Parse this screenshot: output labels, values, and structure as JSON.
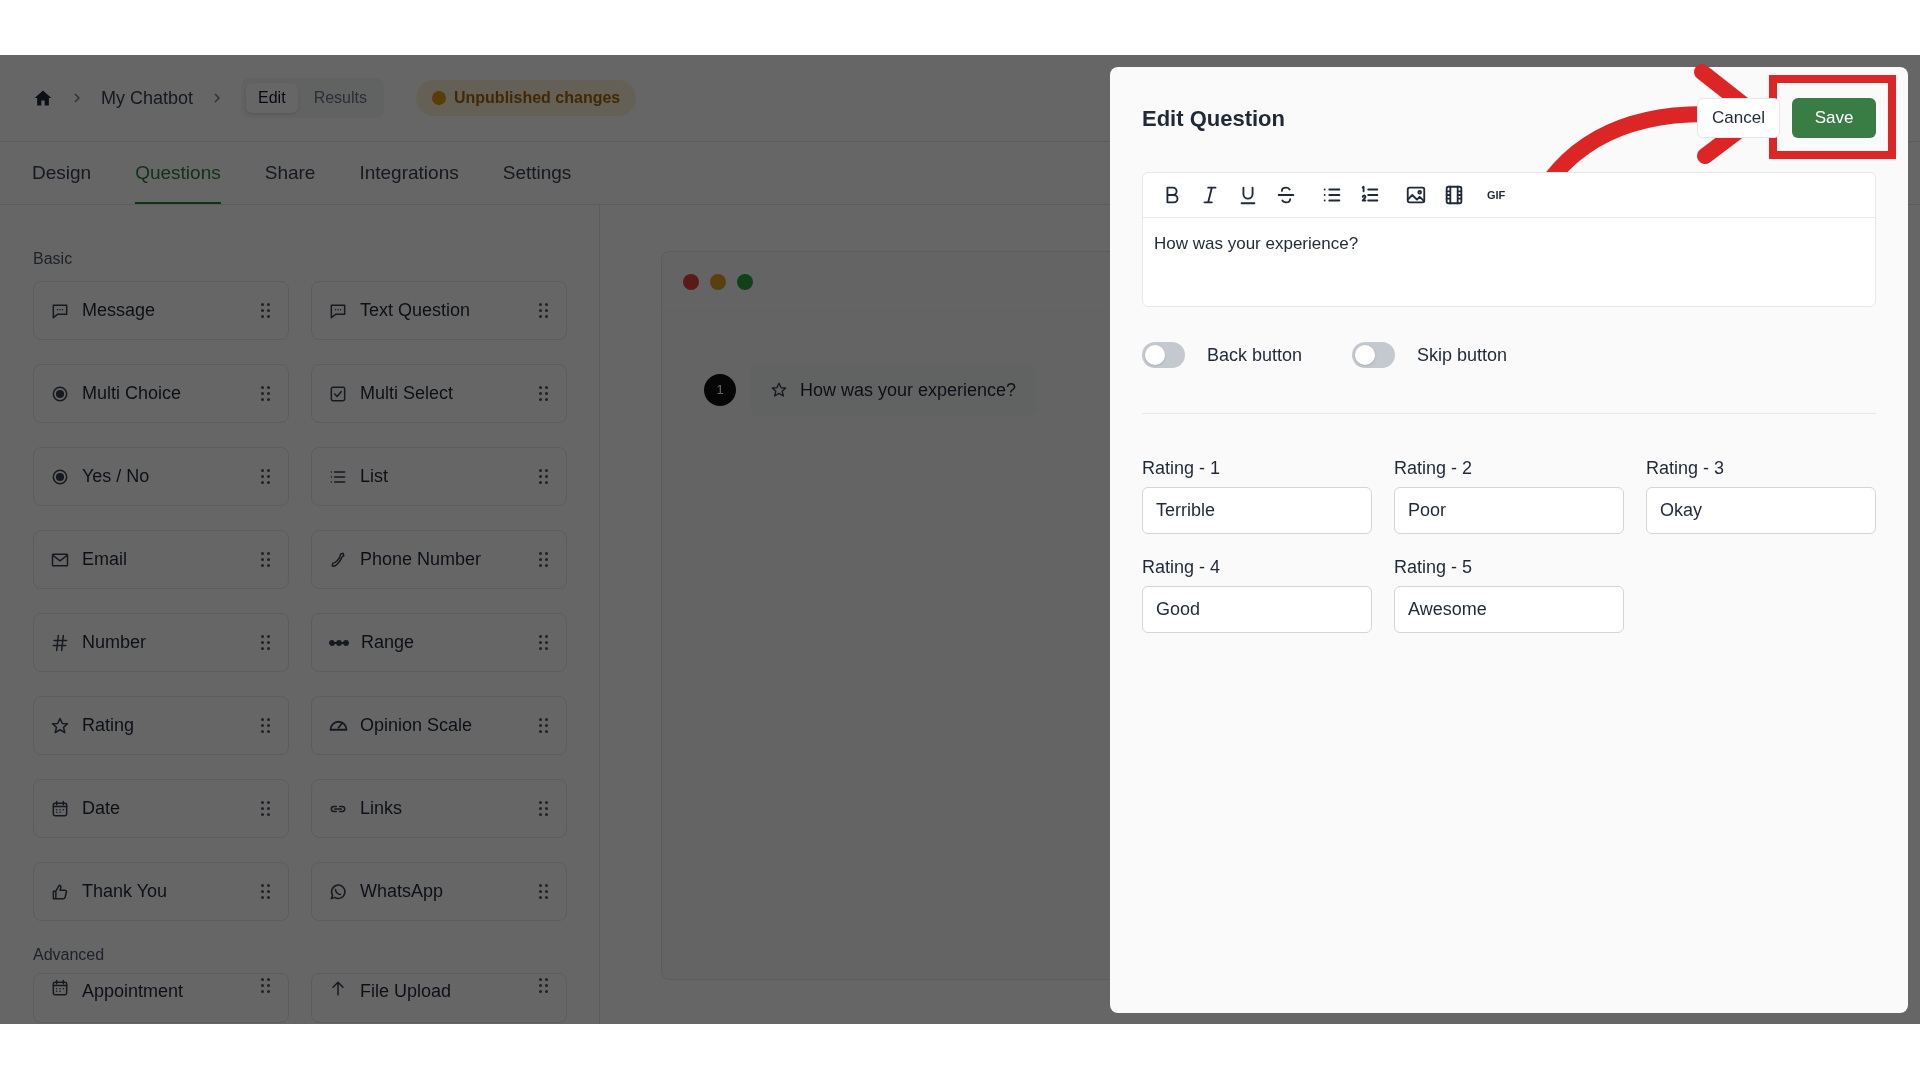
{
  "breadcrumb": {
    "items": [
      "My Chatbot"
    ]
  },
  "mode_tabs": [
    {
      "label": "Edit",
      "selected": true
    },
    {
      "label": "Results",
      "selected": false
    }
  ],
  "status_badge": {
    "label": "Unpublished changes"
  },
  "nav_tabs": [
    {
      "label": "Design",
      "selected": false
    },
    {
      "label": "Questions",
      "selected": true
    },
    {
      "label": "Share",
      "selected": false
    },
    {
      "label": "Integrations",
      "selected": false
    },
    {
      "label": "Settings",
      "selected": false
    }
  ],
  "palette": [
    {
      "title": "Basic",
      "items": [
        "Message",
        "Text Question",
        "Multi Choice",
        "Multi Select",
        "Yes / No",
        "List",
        "Email",
        "Phone Number",
        "Number",
        "Range",
        "Rating",
        "Opinion Scale",
        "Date",
        "Links",
        "Thank You",
        "WhatsApp"
      ]
    },
    {
      "title": "Advanced",
      "items": [
        "Appointment",
        "File Upload"
      ]
    }
  ],
  "preview": {
    "questions": [
      {
        "number": "1",
        "text": "How was your experience?"
      }
    ]
  },
  "editor": {
    "title": "Edit Question",
    "cancel": "Cancel",
    "save": "Save",
    "toolbar_gif": "GIF",
    "content": "How was your experience?",
    "toggles": [
      {
        "label": "Back button",
        "on": false
      },
      {
        "label": "Skip button",
        "on": false
      }
    ],
    "ratings": [
      {
        "label": "Rating - 1",
        "value": "Terrible"
      },
      {
        "label": "Rating - 2",
        "value": "Poor"
      },
      {
        "label": "Rating - 3",
        "value": "Okay"
      },
      {
        "label": "Rating - 4",
        "value": "Good"
      },
      {
        "label": "Rating - 5",
        "value": "Awesome"
      }
    ]
  }
}
